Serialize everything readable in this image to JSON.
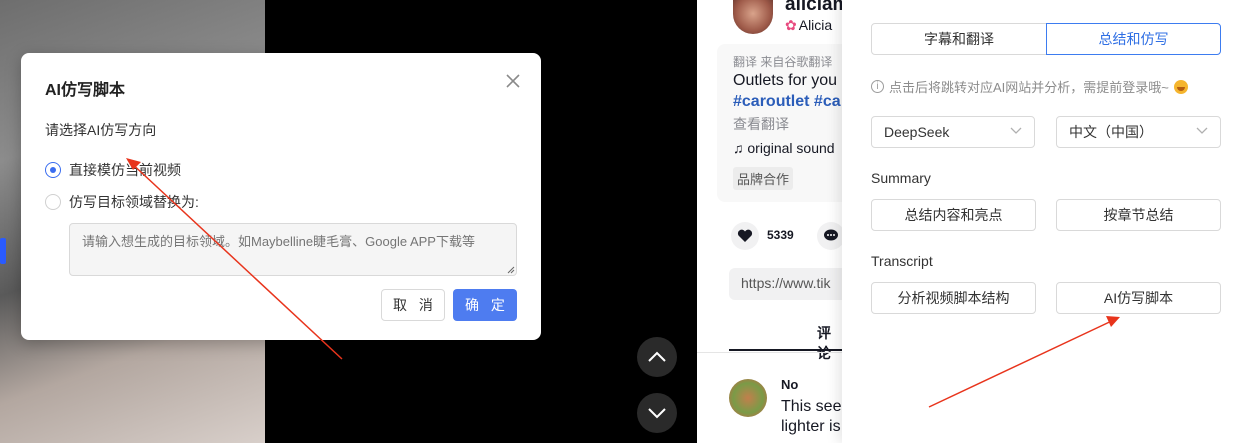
{
  "colors": {
    "accent": "#3a6df0",
    "arrow": "#e8341c",
    "link": "#2b5db9"
  },
  "tiktok": {
    "username": "aliciam",
    "nickname": "Alicia",
    "translate_line": "翻译  来自谷歌翻译",
    "description": "Outlets for you",
    "tags": "#caroutlet #ca",
    "see_translation": "查看翻译",
    "sound": "original sound",
    "brand_tag": "品牌合作",
    "like_count": "5339",
    "url": "https://www.tik",
    "comments_tab": "评论",
    "comment": {
      "author": "No",
      "line1": "This see",
      "line2": "lighter is"
    }
  },
  "extension": {
    "tabs": [
      "字幕和翻译",
      "总结和仿写"
    ],
    "active_tab": "总结和仿写",
    "hint": "点击后将跳转对应AI网站并分析，需提前登录哦~",
    "model_select": "DeepSeek",
    "language_select": "中文（中国）",
    "summary_label": "Summary",
    "summary_buttons": [
      "总结内容和亮点",
      "按章节总结"
    ],
    "transcript_label": "Transcript",
    "transcript_buttons": [
      "分析视频脚本结构",
      "AI仿写脚本"
    ]
  },
  "modal": {
    "title": "AI仿写脚本",
    "subtitle": "请选择AI仿写方向",
    "options": [
      "直接模仿当前视频",
      "仿写目标领域替换为:"
    ],
    "selected_option": "直接模仿当前视频",
    "textarea_placeholder": "请输入想生成的目标领域。如Maybelline睫毛膏、Google APP下载等",
    "cancel_label": "取 消",
    "confirm_label": "确 定"
  }
}
